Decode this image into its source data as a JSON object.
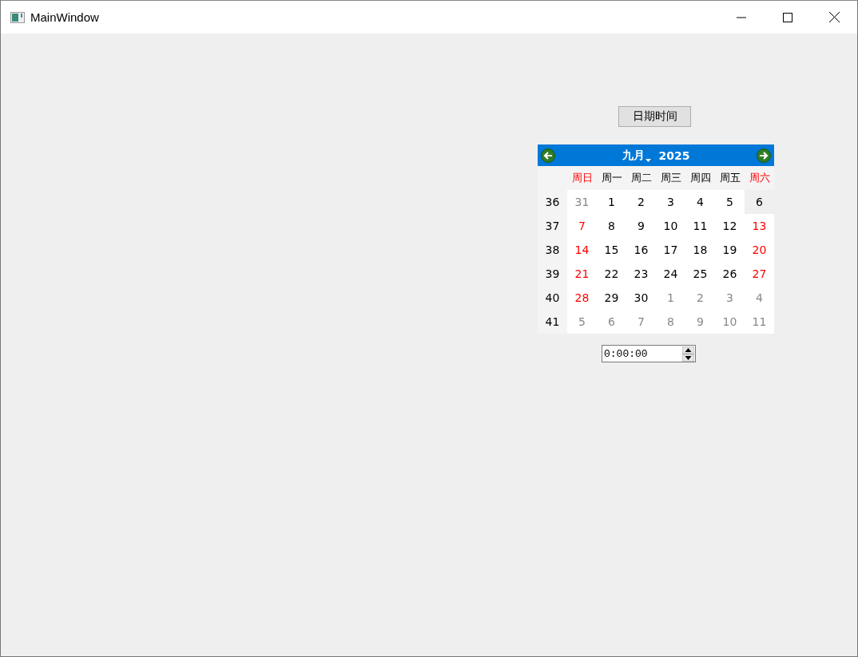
{
  "window": {
    "title": "MainWindow"
  },
  "button": {
    "label": "日期时间"
  },
  "calendar": {
    "month": "九月",
    "year": "2025",
    "weekdays": [
      {
        "label": "周日",
        "weekend": true
      },
      {
        "label": "周一",
        "weekend": false
      },
      {
        "label": "周二",
        "weekend": false
      },
      {
        "label": "周三",
        "weekend": false
      },
      {
        "label": "周四",
        "weekend": false
      },
      {
        "label": "周五",
        "weekend": false
      },
      {
        "label": "周六",
        "weekend": true
      }
    ],
    "weeks": [
      {
        "week": "36",
        "days": [
          {
            "day": "31",
            "other_month": true,
            "selected": false
          },
          {
            "day": "1",
            "other_month": false,
            "selected": false
          },
          {
            "day": "2",
            "other_month": false,
            "selected": false
          },
          {
            "day": "3",
            "other_month": false,
            "selected": false
          },
          {
            "day": "4",
            "other_month": false,
            "selected": false
          },
          {
            "day": "5",
            "other_month": false,
            "selected": false
          },
          {
            "day": "6",
            "other_month": false,
            "selected": true
          }
        ]
      },
      {
        "week": "37",
        "days": [
          {
            "day": "7",
            "other_month": false,
            "selected": false
          },
          {
            "day": "8",
            "other_month": false,
            "selected": false
          },
          {
            "day": "9",
            "other_month": false,
            "selected": false
          },
          {
            "day": "10",
            "other_month": false,
            "selected": false
          },
          {
            "day": "11",
            "other_month": false,
            "selected": false
          },
          {
            "day": "12",
            "other_month": false,
            "selected": false
          },
          {
            "day": "13",
            "other_month": false,
            "selected": false
          }
        ]
      },
      {
        "week": "38",
        "days": [
          {
            "day": "14",
            "other_month": false,
            "selected": false
          },
          {
            "day": "15",
            "other_month": false,
            "selected": false
          },
          {
            "day": "16",
            "other_month": false,
            "selected": false
          },
          {
            "day": "17",
            "other_month": false,
            "selected": false
          },
          {
            "day": "18",
            "other_month": false,
            "selected": false
          },
          {
            "day": "19",
            "other_month": false,
            "selected": false
          },
          {
            "day": "20",
            "other_month": false,
            "selected": false
          }
        ]
      },
      {
        "week": "39",
        "days": [
          {
            "day": "21",
            "other_month": false,
            "selected": false
          },
          {
            "day": "22",
            "other_month": false,
            "selected": false
          },
          {
            "day": "23",
            "other_month": false,
            "selected": false
          },
          {
            "day": "24",
            "other_month": false,
            "selected": false
          },
          {
            "day": "25",
            "other_month": false,
            "selected": false
          },
          {
            "day": "26",
            "other_month": false,
            "selected": false
          },
          {
            "day": "27",
            "other_month": false,
            "selected": false
          }
        ]
      },
      {
        "week": "40",
        "days": [
          {
            "day": "28",
            "other_month": false,
            "selected": false
          },
          {
            "day": "29",
            "other_month": false,
            "selected": false
          },
          {
            "day": "30",
            "other_month": false,
            "selected": false
          },
          {
            "day": "1",
            "other_month": true,
            "selected": false
          },
          {
            "day": "2",
            "other_month": true,
            "selected": false
          },
          {
            "day": "3",
            "other_month": true,
            "selected": false
          },
          {
            "day": "4",
            "other_month": true,
            "selected": false
          }
        ]
      },
      {
        "week": "41",
        "days": [
          {
            "day": "5",
            "other_month": true,
            "selected": false
          },
          {
            "day": "6",
            "other_month": true,
            "selected": false
          },
          {
            "day": "7",
            "other_month": true,
            "selected": false
          },
          {
            "day": "8",
            "other_month": true,
            "selected": false
          },
          {
            "day": "9",
            "other_month": true,
            "selected": false
          },
          {
            "day": "10",
            "other_month": true,
            "selected": false
          },
          {
            "day": "11",
            "other_month": true,
            "selected": false
          }
        ]
      }
    ]
  },
  "time_edit": {
    "value": "0:00:00"
  }
}
